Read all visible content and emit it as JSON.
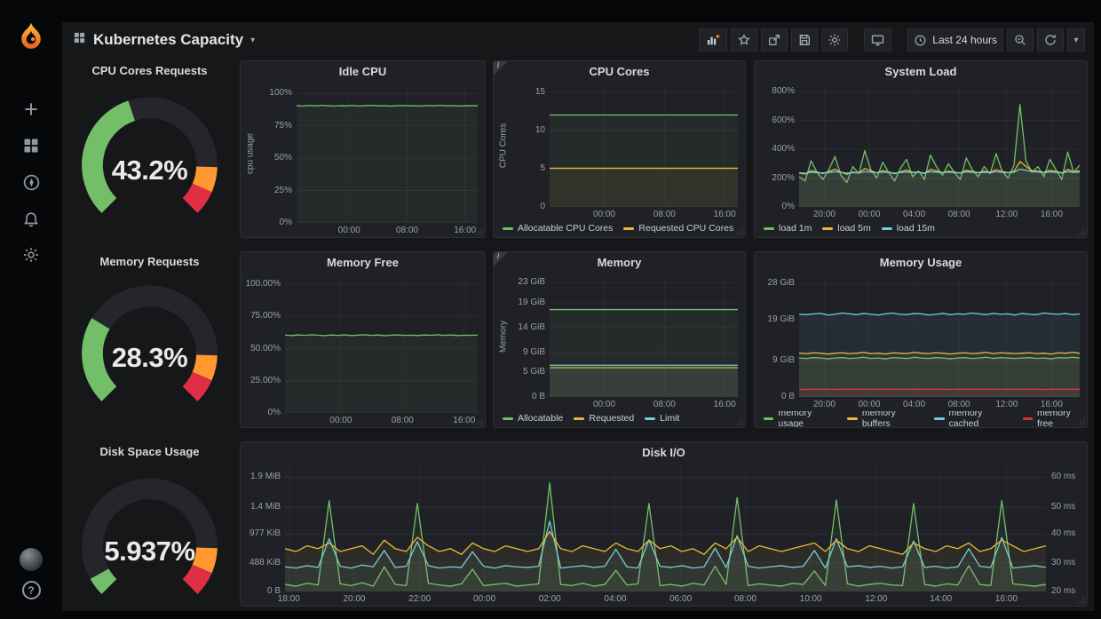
{
  "icons": {
    "caret": "▾",
    "question": "?",
    "info": "i"
  },
  "colors": {
    "green": "#73bf69",
    "yellow": "#eab839",
    "blue": "#6ed0e0",
    "red": "#e02f44",
    "orange": "#ff9830",
    "brand": "#f8a12e"
  },
  "sidebar": {
    "items": [
      {
        "name": "create",
        "icon": "plus-icon"
      },
      {
        "name": "dashboards",
        "icon": "grid-icon"
      },
      {
        "name": "explore",
        "icon": "compass-icon"
      },
      {
        "name": "alerting",
        "icon": "bell-icon"
      },
      {
        "name": "configuration",
        "icon": "gear-icon"
      }
    ]
  },
  "header": {
    "title": "Kubernetes Capacity",
    "time_range": "Last 24 hours"
  },
  "gauges": [
    {
      "title": "CPU Cores Requests",
      "value": "43.2%",
      "percent": 43.2
    },
    {
      "title": "Memory Requests",
      "value": "28.3%",
      "percent": 28.3
    },
    {
      "title": "Disk Space Usage",
      "value": "5.937%",
      "percent": 5.937
    }
  ],
  "charts": [
    {
      "type": "line",
      "title": "Idle CPU",
      "ylabel": "cpu usage",
      "ymin": 0,
      "ymax": 107,
      "show_legend": false,
      "yticks": [
        {
          "label": "0%",
          "v": 0
        },
        {
          "label": "25%",
          "v": 25
        },
        {
          "label": "50%",
          "v": 50
        },
        {
          "label": "75%",
          "v": 75
        },
        {
          "label": "100%",
          "v": 100
        }
      ],
      "xticks": [
        {
          "label": "00:00",
          "f": 0.29
        },
        {
          "label": "08:00",
          "f": 0.61
        },
        {
          "label": "16:00",
          "f": 0.93
        }
      ],
      "series": [
        {
          "name": "",
          "color": "#73bf69",
          "values": [
            90.6,
            90.3,
            90.7,
            90.4,
            90.8,
            90.5,
            90.2,
            90.6,
            90.4,
            90.7,
            90.3,
            90.6,
            90.8,
            90.4,
            90.6,
            90.2,
            90.5,
            90.7,
            90.4,
            90.6,
            90.3,
            90.7,
            90.5,
            90.8,
            90.4,
            90.6,
            90.3,
            90.6,
            90.5,
            90.6
          ]
        }
      ]
    },
    {
      "type": "line",
      "title": "CPU Cores",
      "ylabel": "CPU Cores",
      "ymin": 0,
      "ymax": 16,
      "show_legend": true,
      "yticks": [
        {
          "label": "0",
          "v": 0
        },
        {
          "label": "5",
          "v": 5
        },
        {
          "label": "10",
          "v": 10
        },
        {
          "label": "15",
          "v": 15
        }
      ],
      "xticks": [
        {
          "label": "00:00",
          "f": 0.29
        },
        {
          "label": "08:00",
          "f": 0.61
        },
        {
          "label": "16:00",
          "f": 0.93
        }
      ],
      "series": [
        {
          "name": "Allocatable CPU Cores",
          "color": "#73bf69",
          "values": [
            12,
            12,
            12,
            12
          ]
        },
        {
          "name": "Requested CPU Cores",
          "color": "#eab839",
          "values": [
            5.05,
            5.05,
            5.05,
            5.05
          ]
        }
      ]
    },
    {
      "type": "line",
      "title": "System Load",
      "ylabel": "",
      "ymin": 0,
      "ymax": 850,
      "show_legend": true,
      "yticks": [
        {
          "label": "0%",
          "v": 0
        },
        {
          "label": "200%",
          "v": 200
        },
        {
          "label": "400%",
          "v": 400
        },
        {
          "label": "600%",
          "v": 600
        },
        {
          "label": "800%",
          "v": 800
        }
      ],
      "xticks": [
        {
          "label": "20:00",
          "f": 0.09
        },
        {
          "label": "00:00",
          "f": 0.25
        },
        {
          "label": "04:00",
          "f": 0.41
        },
        {
          "label": "08:00",
          "f": 0.57
        },
        {
          "label": "12:00",
          "f": 0.74
        },
        {
          "label": "16:00",
          "f": 0.9
        }
      ],
      "series": [
        {
          "name": "load 1m",
          "color": "#73bf69",
          "values": [
            210,
            180,
            320,
            240,
            190,
            260,
            350,
            220,
            170,
            280,
            230,
            390,
            260,
            200,
            310,
            240,
            180,
            270,
            330,
            210,
            250,
            190,
            360,
            280,
            220,
            300,
            240,
            190,
            340,
            260,
            210,
            280,
            230,
            370,
            250,
            200,
            290,
            710,
            320,
            240,
            280,
            210,
            330,
            260,
            190,
            380,
            240,
            290
          ]
        },
        {
          "name": "load 5m",
          "color": "#eab839",
          "values": [
            235,
            228,
            252,
            242,
            232,
            246,
            262,
            242,
            226,
            242,
            236,
            266,
            252,
            236,
            252,
            242,
            230,
            244,
            256,
            240,
            242,
            232,
            260,
            250,
            238,
            248,
            242,
            234,
            254,
            246,
            238,
            248,
            240,
            258,
            246,
            238,
            248,
            315,
            282,
            252,
            248,
            240,
            254,
            246,
            236,
            260,
            244,
            250
          ]
        },
        {
          "name": "load 15m",
          "color": "#6ed0e0",
          "values": [
            237,
            234,
            240,
            238,
            236,
            239,
            244,
            240,
            235,
            238,
            237,
            244,
            242,
            237,
            242,
            239,
            235,
            239,
            243,
            238,
            240,
            236,
            244,
            241,
            238,
            241,
            239,
            236,
            243,
            240,
            237,
            240,
            238,
            244,
            240,
            237,
            241,
            262,
            254,
            246,
            242,
            238,
            243,
            240,
            236,
            244,
            240,
            242
          ]
        }
      ]
    },
    {
      "type": "line",
      "title": "Memory Free",
      "ylabel": "",
      "ymin": 0,
      "ymax": 107,
      "show_legend": false,
      "yticks": [
        {
          "label": "0%",
          "v": 0
        },
        {
          "label": "25.00%",
          "v": 25
        },
        {
          "label": "50.00%",
          "v": 50
        },
        {
          "label": "75.00%",
          "v": 75
        },
        {
          "label": "100.00%",
          "v": 100
        }
      ],
      "xticks": [
        {
          "label": "00:00",
          "f": 0.29
        },
        {
          "label": "08:00",
          "f": 0.61
        },
        {
          "label": "16:00",
          "f": 0.93
        }
      ],
      "series": [
        {
          "name": "",
          "color": "#73bf69",
          "values": [
            60.5,
            60.2,
            60.7,
            60.3,
            60.8,
            60.4,
            60.1,
            60.6,
            60.3,
            60.7,
            60.2,
            60.5,
            60.8,
            60.3,
            60.6,
            60.1,
            60.5,
            60.7,
            60.3,
            60.5,
            60.2,
            60.6,
            60.4,
            60.8,
            60.3,
            60.6,
            60.2,
            60.5,
            60.4,
            60.5
          ]
        }
      ]
    },
    {
      "type": "line",
      "title": "Memory",
      "ylabel": "Memory",
      "ymin": 0,
      "ymax": 24.5,
      "show_legend": true,
      "yticks": [
        {
          "label": "0 B",
          "v": 0
        },
        {
          "label": "5 GiB",
          "v": 5
        },
        {
          "label": "9 GiB",
          "v": 9
        },
        {
          "label": "14 GiB",
          "v": 14
        },
        {
          "label": "19 GiB",
          "v": 19
        },
        {
          "label": "23 GiB",
          "v": 23
        }
      ],
      "xticks": [
        {
          "label": "00:00",
          "f": 0.29
        },
        {
          "label": "08:00",
          "f": 0.61
        },
        {
          "label": "16:00",
          "f": 0.93
        }
      ],
      "series": [
        {
          "name": "Allocatable",
          "color": "#73bf69",
          "values": [
            17.6,
            17.6,
            17.6,
            17.6
          ]
        },
        {
          "name": "Requested",
          "color": "#eab839",
          "values": [
            5.9,
            5.9,
            5.9,
            5.9
          ]
        },
        {
          "name": "Limit",
          "color": "#6ed0e0",
          "values": [
            6.4,
            6.4,
            6.4,
            6.4
          ]
        }
      ]
    },
    {
      "type": "line",
      "title": "Memory Usage",
      "ylabel": "",
      "ymin": 0,
      "ymax": 30,
      "show_legend": true,
      "yticks": [
        {
          "label": "0 B",
          "v": 0
        },
        {
          "label": "9 GiB",
          "v": 9
        },
        {
          "label": "19 GiB",
          "v": 19
        },
        {
          "label": "28 GiB",
          "v": 28
        }
      ],
      "xticks": [
        {
          "label": "20:00",
          "f": 0.09
        },
        {
          "label": "00:00",
          "f": 0.25
        },
        {
          "label": "04:00",
          "f": 0.41
        },
        {
          "label": "08:00",
          "f": 0.57
        },
        {
          "label": "12:00",
          "f": 0.74
        },
        {
          "label": "16:00",
          "f": 0.9
        }
      ],
      "series": [
        {
          "name": "memory usage",
          "color": "#73bf69",
          "values": [
            9.6,
            9.5,
            9.7,
            9.6,
            9.4,
            9.6,
            9.7,
            9.5,
            9.6,
            9.8,
            9.5,
            9.6,
            9.4,
            9.7,
            9.6,
            9.5,
            9.8,
            9.6,
            9.5,
            9.7,
            9.6,
            9.4,
            9.6,
            9.7,
            9.5,
            9.6,
            9.8,
            9.5,
            9.7,
            9.6,
            9.5,
            9.6,
            9.7,
            9.5,
            9.6,
            9.4,
            9.7,
            9.6,
            9.8,
            9.6
          ]
        },
        {
          "name": "memory buffers",
          "color": "#eab839",
          "values": [
            10.8,
            10.7,
            10.9,
            10.8,
            10.6,
            10.8,
            10.9,
            10.7,
            10.8,
            11.0,
            10.7,
            10.8,
            10.6,
            10.9,
            10.8,
            10.7,
            11.0,
            10.8,
            10.7,
            10.9,
            10.8,
            10.6,
            10.8,
            10.9,
            10.7,
            10.8,
            11.0,
            10.7,
            10.9,
            10.8,
            10.7,
            10.8,
            10.9,
            10.7,
            10.8,
            10.6,
            10.9,
            10.8,
            11.0,
            10.8
          ]
        },
        {
          "name": "memory cached",
          "color": "#6ed0e0",
          "values": [
            20.4,
            20.3,
            20.5,
            20.6,
            20.2,
            20.4,
            20.7,
            20.5,
            20.3,
            20.6,
            20.4,
            20.2,
            20.5,
            20.7,
            20.4,
            20.3,
            20.6,
            20.5,
            20.2,
            20.4,
            20.6,
            20.3,
            20.5,
            20.4,
            20.7,
            20.5,
            20.3,
            20.6,
            20.4,
            20.5,
            20.2,
            20.6,
            20.4,
            20.3,
            20.7,
            20.5,
            20.4,
            20.6,
            20.3,
            20.5
          ]
        },
        {
          "name": "memory free",
          "color": "#e02f44",
          "values": [
            1.9,
            1.85,
            1.9,
            1.88,
            1.92,
            1.87,
            1.9,
            1.93,
            1.88,
            1.9,
            1.86,
            1.9,
            1.92,
            1.88,
            1.9,
            1.87,
            1.93,
            1.9,
            1.88,
            1.9,
            1.92,
            1.87,
            1.9,
            1.88,
            1.9,
            1.93,
            1.88,
            1.9,
            1.86,
            1.9,
            1.92,
            1.88,
            1.9,
            1.9,
            1.87,
            1.9,
            1.92,
            1.88,
            1.9,
            1.9
          ]
        }
      ]
    },
    {
      "type": "line",
      "title": "Disk I/O",
      "ylabel": "",
      "ymin": 0,
      "ymax": 2150,
      "show_legend": false,
      "yticks": [
        {
          "label": "0 B",
          "v": 0
        },
        {
          "label": "488 KiB",
          "v": 488
        },
        {
          "label": "977 KiB",
          "v": 977
        },
        {
          "label": "1.4 MiB",
          "v": 1434
        },
        {
          "label": "1.9 MiB",
          "v": 1946
        }
      ],
      "yticks_right": [
        {
          "label": "20 ms",
          "v": 0
        },
        {
          "label": "30 ms",
          "v": 488
        },
        {
          "label": "40 ms",
          "v": 977
        },
        {
          "label": "50 ms",
          "v": 1434
        },
        {
          "label": "60 ms",
          "v": 1946
        }
      ],
      "xticks": [
        {
          "label": "18:00",
          "f": 0.005
        },
        {
          "label": "20:00",
          "f": 0.091
        },
        {
          "label": "22:00",
          "f": 0.177
        },
        {
          "label": "00:00",
          "f": 0.262
        },
        {
          "label": "02:00",
          "f": 0.348
        },
        {
          "label": "04:00",
          "f": 0.434
        },
        {
          "label": "06:00",
          "f": 0.52
        },
        {
          "label": "08:00",
          "f": 0.605
        },
        {
          "label": "10:00",
          "f": 0.691
        },
        {
          "label": "12:00",
          "f": 0.777
        },
        {
          "label": "14:00",
          "f": 0.862
        },
        {
          "label": "16:00",
          "f": 0.948
        }
      ],
      "series": [
        {
          "name": "",
          "color": "#73bf69",
          "values": [
            120,
            90,
            140,
            110,
            1550,
            130,
            100,
            150,
            90,
            420,
            120,
            100,
            1500,
            140,
            110,
            90,
            130,
            380,
            100,
            120,
            140,
            90,
            110,
            130,
            1850,
            120,
            100,
            140,
            90,
            120,
            360,
            110,
            130,
            1500,
            100,
            120,
            90,
            140,
            110,
            430,
            120,
            1600,
            100,
            130,
            110,
            90,
            140,
            120,
            350,
            100,
            1560,
            130,
            90,
            120,
            140,
            110,
            100,
            1500,
            120,
            90,
            130,
            110,
            440,
            120,
            100,
            1550,
            130,
            110,
            90,
            120
          ]
        },
        {
          "name": "",
          "color": "#6ed0e0",
          "values": [
            420,
            400,
            440,
            410,
            900,
            430,
            400,
            450,
            420,
            700,
            410,
            430,
            850,
            440,
            400,
            420,
            410,
            680,
            430,
            400,
            440,
            420,
            410,
            430,
            1200,
            400,
            420,
            440,
            410,
            430,
            720,
            420,
            400,
            880,
            430,
            410,
            440,
            400,
            420,
            740,
            410,
            950,
            430,
            400,
            420,
            440,
            410,
            430,
            700,
            400,
            900,
            420,
            440,
            410,
            430,
            400,
            420,
            860,
            410,
            430,
            400,
            420,
            730,
            430,
            410,
            920,
            400,
            420,
            440,
            410
          ]
        },
        {
          "name": "",
          "color": "#eab839",
          "ymin": 20,
          "ymax": 64.2,
          "values": [
            35,
            34,
            36,
            35,
            37,
            34,
            35,
            36,
            33,
            38,
            35,
            34,
            39,
            36,
            34,
            35,
            33,
            37,
            35,
            34,
            36,
            35,
            34,
            35,
            41,
            35,
            34,
            36,
            35,
            34,
            37,
            35,
            34,
            38,
            35,
            36,
            34,
            35,
            33,
            37,
            35,
            39,
            34,
            36,
            35,
            34,
            35,
            36,
            37,
            34,
            38,
            35,
            34,
            36,
            35,
            34,
            33,
            37,
            35,
            34,
            36,
            35,
            37,
            34,
            35,
            38,
            36,
            34,
            35,
            36
          ]
        }
      ]
    }
  ]
}
